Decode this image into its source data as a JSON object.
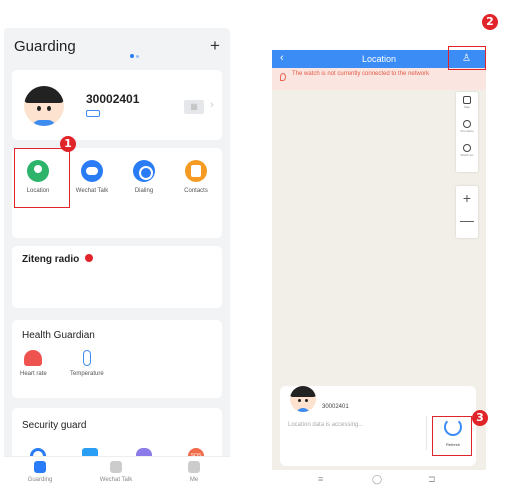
{
  "left_phone": {
    "header": {
      "title": "Guarding",
      "add_icon": "+"
    },
    "profile": {
      "device_id": "30002401"
    },
    "actions": [
      {
        "label": "Location",
        "icon": "location-icon"
      },
      {
        "label": "Wechat Talk",
        "icon": "chat-icon"
      },
      {
        "label": "Dialing",
        "icon": "phone-icon"
      },
      {
        "label": "Contacts",
        "icon": "contacts-icon"
      }
    ],
    "radio_card": {
      "title": "Ziteng radio"
    },
    "health_card": {
      "title": "Health Guardian",
      "items": [
        {
          "label": "Heart rate",
          "icon": "heart-icon"
        },
        {
          "label": "Temperature",
          "icon": "thermometer-icon"
        }
      ]
    },
    "security_card": {
      "title": "Security guard",
      "sos_label": "SOS"
    },
    "bottom_nav": [
      {
        "label": "Guarding",
        "active": true
      },
      {
        "label": "Wechat Talk",
        "active": false
      },
      {
        "label": "Me",
        "active": false
      }
    ]
  },
  "right_phone": {
    "header": {
      "back_icon": "‹",
      "title": "Location",
      "user_icon": "♙"
    },
    "warning": {
      "text": "The watch is not currently connected to the network"
    },
    "map_tools": [
      {
        "label": "Map",
        "icon": "layers-icon"
      },
      {
        "label": "Sim Alerts",
        "icon": "sim-icon"
      },
      {
        "label": "Watch loc",
        "icon": "target-icon"
      }
    ],
    "zoom": {
      "plus": "+",
      "minus": "—"
    },
    "panel": {
      "device_id": "30002401",
      "status": "Location data is accessing...",
      "refresh_label": "Refresh"
    },
    "system_nav": {
      "menu": "≡",
      "home": "◯",
      "back": "⊐"
    }
  },
  "callouts": {
    "one": "1",
    "two": "2",
    "three": "3"
  },
  "colors": {
    "accent": "#2b7cf7",
    "highlight": "#e0242a"
  }
}
